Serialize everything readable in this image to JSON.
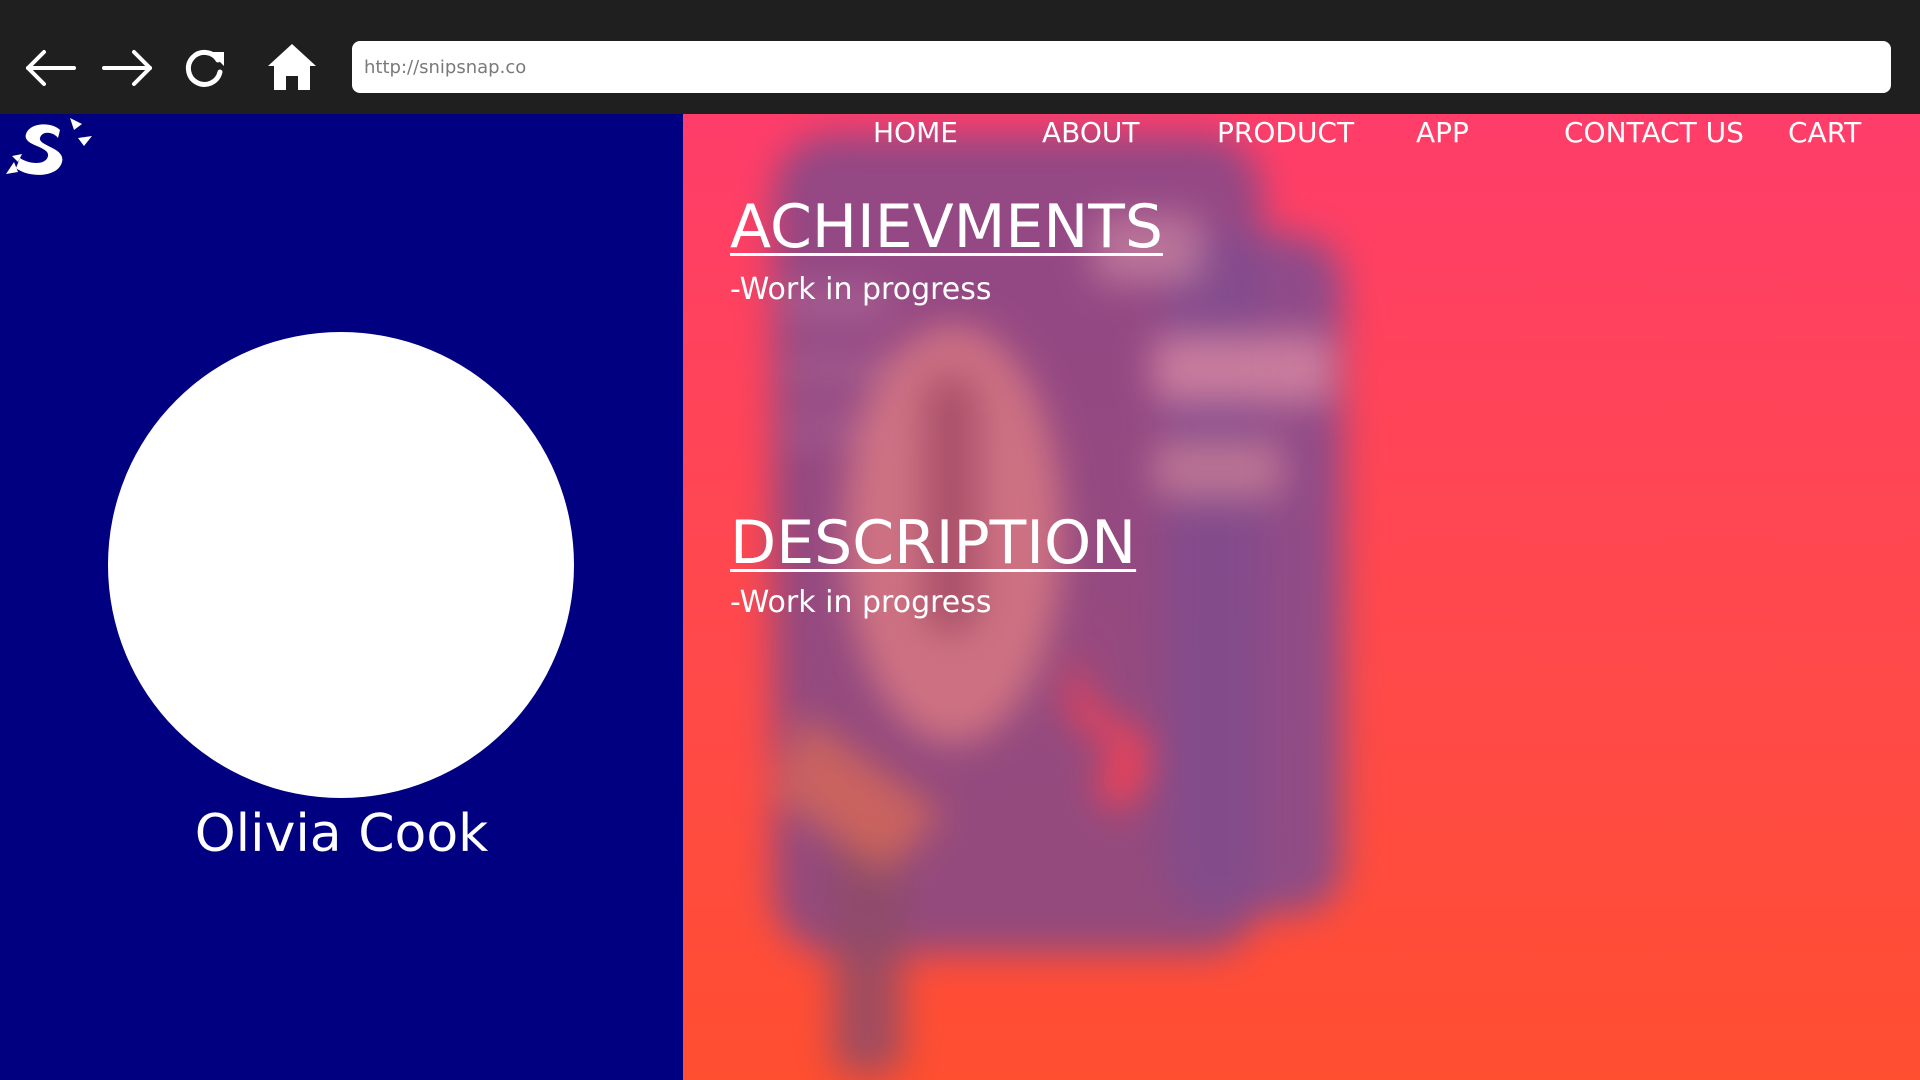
{
  "browser": {
    "url": "http://snipsnap.co",
    "icons": [
      "back-arrow-icon",
      "forward-arrow-icon",
      "reload-icon",
      "home-icon"
    ]
  },
  "nav": {
    "items": [
      "HOME",
      "ABOUT",
      "PRODUCT",
      "APP",
      "CONTACT US",
      "CART"
    ]
  },
  "profile": {
    "name": "Olivia Cook"
  },
  "sections": {
    "achievements": {
      "title": "ACHIEVMENTS",
      "body": "-Work in progress"
    },
    "description": {
      "title": "DESCRIPTION",
      "body": "-Work in progress"
    }
  },
  "colors": {
    "chrome": "#1f1f1f",
    "left_panel": "#010080",
    "right_gradient_top": "#ff3d6a",
    "right_gradient_bottom": "#ff4e30",
    "text": "#ffffff"
  }
}
